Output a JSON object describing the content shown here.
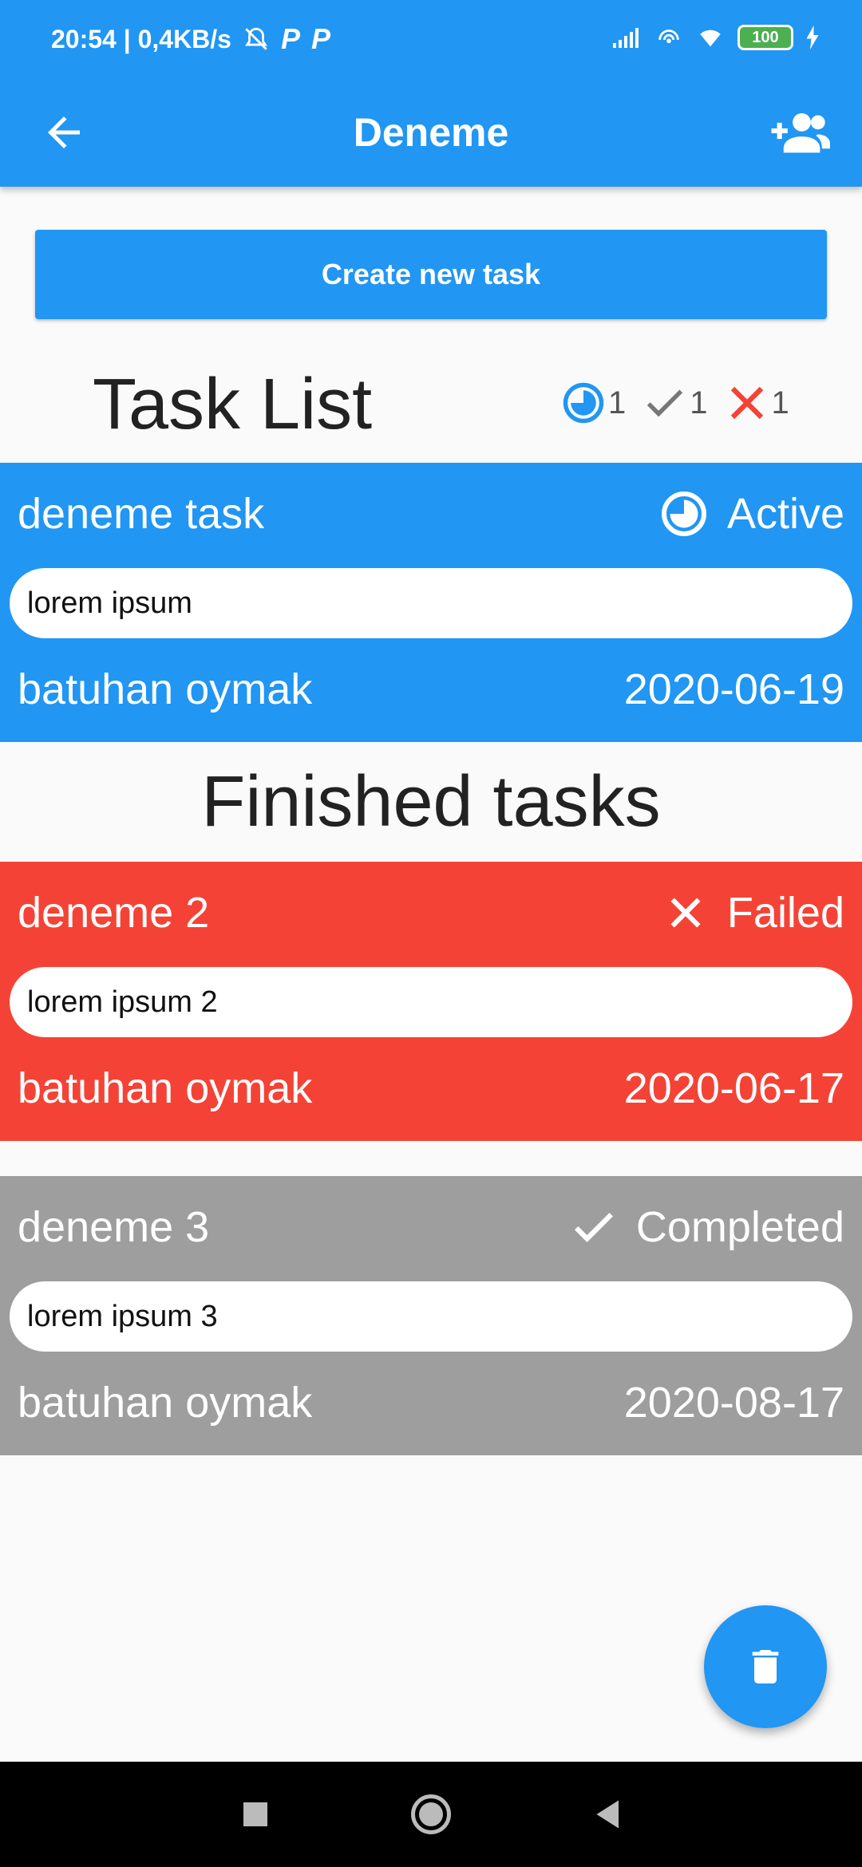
{
  "status_bar": {
    "time_speed": "20:54 | 0,4KB/s",
    "p1": "P",
    "p2": "P",
    "battery": "100"
  },
  "app_bar": {
    "title": "Deneme"
  },
  "create_button": {
    "label": "Create new task"
  },
  "task_list": {
    "title": "Task List",
    "counts": {
      "active": "1",
      "completed": "1",
      "failed": "1"
    }
  },
  "finished_title": "Finished tasks",
  "tasks": [
    {
      "name": "deneme task",
      "status": "Active",
      "description": "lorem ipsum",
      "author": "batuhan oymak",
      "date": "2020-06-19",
      "color": "#2196f3"
    },
    {
      "name": "deneme 2",
      "status": "Failed",
      "description": "lorem ipsum 2",
      "author": "batuhan oymak",
      "date": "2020-06-17",
      "color": "#f44336"
    },
    {
      "name": "deneme 3",
      "status": "Completed",
      "description": "lorem ipsum 3",
      "author": "batuhan oymak",
      "date": "2020-08-17",
      "color": "#9e9e9e"
    }
  ],
  "icons": {
    "back": "arrow-back-icon",
    "add_user": "add-user-icon",
    "active": "clock-pie-icon",
    "completed": "check-icon",
    "failed": "close-icon",
    "fab": "trash-icon"
  }
}
